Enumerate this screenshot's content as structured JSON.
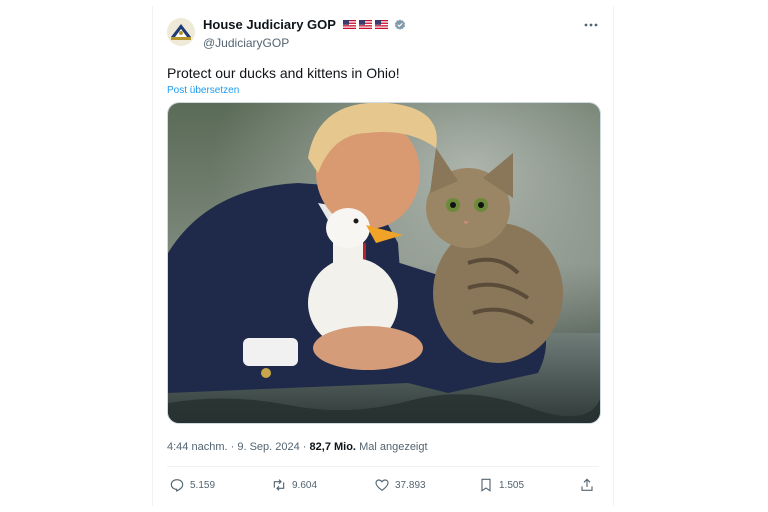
{
  "account": {
    "name": "House Judiciary GOP",
    "handle": "@JudiciaryGOP"
  },
  "tweet": {
    "text": "Protect our ducks and kittens in Ohio!",
    "translate_label": "Post übersetzen",
    "time": "4:44 nachm.",
    "separator": "·",
    "date": "9. Sep. 2024",
    "views_count": "82,7 Mio.",
    "views_label": "Mal angezeigt"
  },
  "stats": {
    "replies": "5.159",
    "reposts": "9.604",
    "likes": "37.893",
    "bookmarks": "1.505"
  },
  "colors": {
    "accent": "#1d9bf0",
    "text": "#0f1419",
    "muted": "#536471"
  }
}
